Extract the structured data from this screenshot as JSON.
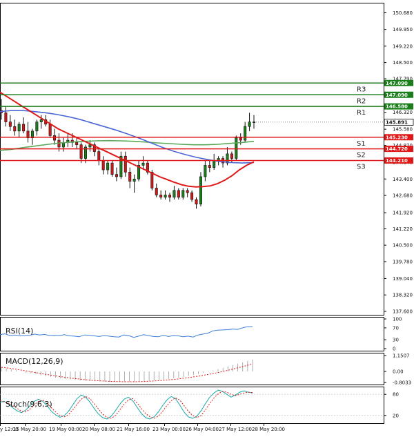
{
  "chart_data": {
    "type": "candlestick",
    "main": {
      "price_axis_ticks": [
        150.68,
        149.95,
        149.22,
        148.5,
        147.79,
        147.06,
        146.32,
        145.58,
        144.87,
        144.14,
        143.4,
        142.68,
        141.92,
        141.22,
        140.5,
        139.78,
        139.04,
        138.32,
        137.6
      ],
      "price_axis_labels": [
        "150.680",
        "149.950",
        "149.220",
        "148.500",
        "147.790",
        "147.060",
        "146.320",
        "145.580",
        "144.870",
        "144.140",
        "143.400",
        "142.680",
        "141.920",
        "141.220",
        "140.500",
        "139.780",
        "139.040",
        "138.320",
        "137.600"
      ],
      "ylim": [
        137.45,
        151.12
      ],
      "current_price": 145.891,
      "current_price_label": "145.891",
      "levels": [
        {
          "name": "R3",
          "value": 147.09,
          "label": "147.090",
          "color": "#1a7f1a"
        },
        {
          "name": "R2",
          "value": 147.09,
          "label": "147.090",
          "color": "#1a7f1a"
        },
        {
          "name": "R1",
          "value": 146.58,
          "label": "146.580",
          "color": "#1a7f1a"
        },
        {
          "name": "S1",
          "value": 145.23,
          "label": "145.230",
          "color": "#e01818"
        },
        {
          "name": "S2",
          "value": 144.72,
          "label": "144.720",
          "color": "#e01818"
        },
        {
          "name": "S3",
          "value": 144.21,
          "label": "144.210",
          "color": "#e01818"
        }
      ],
      "candles": [
        [
          146.4,
          146.9,
          146.0,
          146.3
        ],
        [
          146.3,
          146.6,
          145.7,
          145.9
        ],
        [
          145.9,
          146.2,
          145.5,
          145.7
        ],
        [
          145.7,
          146.0,
          145.3,
          145.5
        ],
        [
          145.5,
          145.9,
          145.2,
          145.8
        ],
        [
          145.8,
          146.1,
          145.4,
          145.5
        ],
        [
          145.5,
          145.9,
          145.0,
          145.2
        ],
        [
          145.2,
          145.6,
          144.9,
          145.5
        ],
        [
          145.5,
          146.0,
          145.3,
          145.9
        ],
        [
          145.9,
          146.2,
          145.6,
          146.0
        ],
        [
          146.0,
          146.2,
          145.7,
          145.8
        ],
        [
          145.8,
          146.0,
          145.2,
          145.3
        ],
        [
          145.3,
          145.6,
          144.9,
          145.1
        ],
        [
          145.1,
          145.4,
          144.6,
          144.8
        ],
        [
          144.8,
          145.2,
          144.6,
          145.0
        ],
        [
          145.0,
          145.4,
          144.8,
          145.1
        ],
        [
          145.1,
          145.4,
          144.8,
          145.0
        ],
        [
          145.0,
          145.2,
          144.7,
          144.9
        ],
        [
          144.9,
          145.0,
          144.1,
          144.3
        ],
        [
          144.3,
          144.9,
          144.1,
          144.8
        ],
        [
          144.8,
          145.1,
          144.6,
          144.9
        ],
        [
          144.9,
          145.0,
          144.4,
          144.6
        ],
        [
          144.6,
          144.7,
          144.0,
          144.2
        ],
        [
          144.2,
          144.4,
          143.6,
          143.8
        ],
        [
          143.8,
          144.2,
          143.6,
          144.1
        ],
        [
          144.1,
          144.2,
          143.5,
          143.6
        ],
        [
          143.6,
          143.9,
          143.3,
          143.5
        ],
        [
          143.5,
          144.6,
          143.4,
          144.4
        ],
        [
          144.4,
          144.6,
          143.5,
          143.7
        ],
        [
          143.7,
          143.9,
          143.0,
          143.3
        ],
        [
          143.3,
          143.6,
          142.8,
          143.4
        ],
        [
          143.4,
          144.2,
          143.3,
          144.0
        ],
        [
          144.0,
          144.4,
          143.8,
          144.1
        ],
        [
          144.1,
          144.2,
          143.6,
          143.7
        ],
        [
          143.7,
          143.8,
          142.9,
          143.0
        ],
        [
          143.0,
          143.2,
          142.6,
          142.7
        ],
        [
          142.7,
          142.9,
          142.5,
          142.6
        ],
        [
          142.6,
          142.9,
          142.5,
          142.7
        ],
        [
          142.7,
          142.8,
          142.4,
          142.6
        ],
        [
          142.6,
          143.1,
          142.5,
          142.9
        ],
        [
          142.9,
          143.0,
          142.5,
          142.6
        ],
        [
          142.6,
          143.0,
          142.5,
          142.9
        ],
        [
          142.9,
          143.0,
          142.6,
          142.8
        ],
        [
          142.8,
          142.9,
          142.4,
          142.5
        ],
        [
          142.5,
          142.6,
          142.1,
          142.3
        ],
        [
          142.3,
          143.7,
          142.2,
          143.5
        ],
        [
          143.5,
          144.2,
          143.3,
          144.0
        ],
        [
          144.0,
          144.2,
          143.7,
          143.9
        ],
        [
          143.9,
          144.5,
          143.8,
          144.2
        ],
        [
          144.2,
          144.4,
          144.0,
          144.3
        ],
        [
          144.3,
          144.4,
          143.9,
          144.1
        ],
        [
          144.1,
          144.8,
          144.0,
          144.5
        ],
        [
          144.5,
          144.6,
          144.1,
          144.3
        ],
        [
          144.3,
          145.3,
          144.2,
          145.2
        ],
        [
          145.2,
          145.4,
          144.9,
          145.1
        ],
        [
          145.1,
          145.9,
          145.0,
          145.7
        ],
        [
          145.7,
          146.3,
          145.5,
          145.9
        ],
        [
          145.9,
          146.2,
          145.6,
          145.9
        ]
      ],
      "ma_red": [
        147.2,
        147.0,
        146.8,
        146.6,
        146.4,
        146.2,
        146.0,
        145.8,
        145.6,
        145.45,
        145.3,
        145.15,
        145.0,
        144.85,
        144.7,
        144.55,
        144.4,
        144.25,
        144.1,
        143.95,
        143.8,
        143.65,
        143.5,
        143.38,
        143.26,
        143.15,
        143.08,
        143.05,
        143.07,
        143.1,
        143.2,
        143.35,
        143.55,
        143.8,
        144.0,
        144.15
      ],
      "ma_blue": [
        146.35,
        146.4,
        146.4,
        146.35,
        146.3,
        146.22,
        146.12,
        146.0,
        145.85,
        145.7,
        145.55,
        145.38,
        145.2,
        145.0,
        144.8,
        144.62,
        144.48,
        144.35,
        144.25,
        144.17,
        144.12,
        144.1,
        144.12
      ],
      "ma_green": [
        144.65,
        144.7,
        144.78,
        144.85,
        144.92,
        144.98,
        145.02,
        145.05,
        145.07,
        145.08,
        145.07,
        145.05,
        145.02,
        144.98,
        144.95,
        144.92,
        144.9,
        144.9,
        144.92,
        144.96,
        145.0,
        145.05
      ]
    },
    "rsi": {
      "label": "RSI(14)",
      "ticks": [
        100,
        70,
        30,
        0
      ],
      "tick_labels": [
        "100",
        "70",
        "30",
        "0"
      ],
      "values": [
        47,
        50,
        44,
        46,
        43,
        44,
        45,
        49,
        46,
        48,
        44,
        45,
        44,
        47,
        43,
        42,
        40,
        46,
        45,
        43,
        41,
        44,
        42,
        40,
        39,
        46,
        44,
        38,
        42,
        47,
        44,
        41,
        40,
        45,
        41,
        44,
        43,
        40,
        42,
        39,
        46,
        49,
        52,
        60,
        62,
        63,
        64,
        66,
        65,
        70,
        74,
        74
      ]
    },
    "macd": {
      "label": "MACD(12,26,9)",
      "ticks": [
        1.1507,
        0.0,
        -0.8033
      ],
      "tick_labels": [
        "1.1507",
        "0.00",
        "-0.8033"
      ],
      "ylim": [
        -0.95,
        1.35
      ],
      "histogram": [
        0.3,
        0.22,
        0.15,
        0.08,
        0.0,
        -0.08,
        -0.15,
        -0.22,
        -0.28,
        -0.34,
        -0.4,
        -0.45,
        -0.5,
        -0.54,
        -0.58,
        -0.62,
        -0.65,
        -0.68,
        -0.7,
        -0.72,
        -0.73,
        -0.74,
        -0.75,
        -0.75,
        -0.76,
        -0.76,
        -0.75,
        -0.74,
        -0.72,
        -0.7,
        -0.68,
        -0.65,
        -0.62,
        -0.58,
        -0.54,
        -0.5,
        -0.45,
        -0.39,
        -0.33,
        -0.26,
        -0.18,
        -0.1,
        -0.02,
        0.07,
        0.16,
        0.26,
        0.36,
        0.46,
        0.56,
        0.66,
        0.76,
        0.86
      ],
      "signal": [
        0.3,
        0.26,
        0.21,
        0.16,
        0.1,
        0.04,
        -0.02,
        -0.09,
        -0.15,
        -0.21,
        -0.27,
        -0.32,
        -0.38,
        -0.43,
        -0.48,
        -0.52,
        -0.56,
        -0.6,
        -0.63,
        -0.66,
        -0.68,
        -0.7,
        -0.72,
        -0.73,
        -0.74,
        -0.75,
        -0.75,
        -0.75,
        -0.74,
        -0.73,
        -0.71,
        -0.69,
        -0.67,
        -0.64,
        -0.61,
        -0.58,
        -0.54,
        -0.49,
        -0.45,
        -0.4,
        -0.34,
        -0.28,
        -0.22,
        -0.15,
        -0.08,
        0.0,
        0.08,
        0.17,
        0.26,
        0.35,
        0.45,
        0.55
      ]
    },
    "stoch": {
      "label": "Stoch(9,6,3)",
      "ticks": [
        80,
        20
      ],
      "tick_labels": [
        "80",
        "20"
      ],
      "k": [
        58,
        60,
        52,
        42,
        33,
        28,
        35,
        48,
        60,
        66,
        60,
        48,
        32,
        22,
        15,
        20,
        32,
        50,
        68,
        78,
        72,
        58,
        40,
        24,
        14,
        10,
        18,
        34,
        52,
        66,
        72,
        62,
        44,
        26,
        14,
        10,
        16,
        30,
        48,
        64,
        74,
        68,
        50,
        30,
        16,
        12,
        18,
        34,
        54,
        72,
        84,
        92,
        88,
        80,
        72,
        78,
        86,
        90,
        86,
        84
      ],
      "d": [
        62,
        58,
        55,
        48,
        40,
        32,
        30,
        38,
        50,
        60,
        64,
        56,
        42,
        30,
        20,
        16,
        22,
        36,
        52,
        66,
        74,
        68,
        54,
        38,
        24,
        14,
        12,
        20,
        36,
        52,
        64,
        68,
        56,
        40,
        26,
        16,
        12,
        18,
        32,
        48,
        62,
        70,
        64,
        48,
        32,
        20,
        14,
        20,
        36,
        54,
        70,
        82,
        88,
        86,
        80,
        76,
        80,
        84,
        86,
        85
      ]
    },
    "time_labels": [
      "y 12:00",
      "15 May 20:00",
      "19 May 00:00",
      "20 May 08:00",
      "21 May 16:00",
      "23 May 00:00",
      "26 May 04:00",
      "27 May 12:00",
      "28 May 20:00"
    ]
  }
}
